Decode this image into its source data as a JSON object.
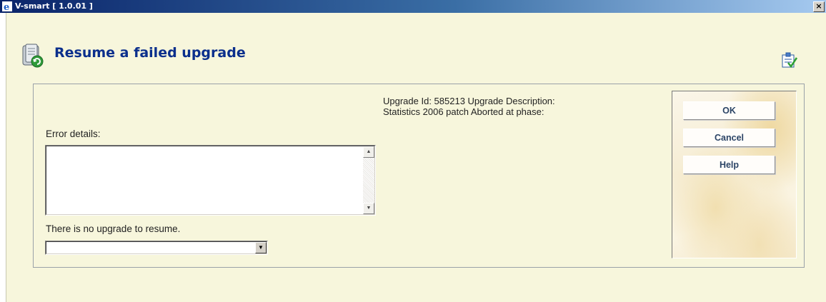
{
  "window": {
    "title": "V-smart [ 1.0.01 ]",
    "close_glyph": "×"
  },
  "page": {
    "title": "Resume a failed upgrade"
  },
  "info": {
    "line1": "Upgrade Id: 585213 Upgrade Description:",
    "line2": "Statistics 2006 patch Aborted at phase:"
  },
  "form": {
    "error_label": "Error details:",
    "error_value": "",
    "status_text": "There is no upgrade to resume.",
    "select_value": ""
  },
  "buttons": {
    "ok": "OK",
    "cancel": "Cancel",
    "help": "Help"
  },
  "icons": {
    "app": "ie-icon",
    "heading": "database-upgrade-icon",
    "corner": "task-check-icon"
  },
  "colors": {
    "title": "#0b2f8c",
    "background": "#f7f6dc",
    "button_text": "#2b4466"
  }
}
